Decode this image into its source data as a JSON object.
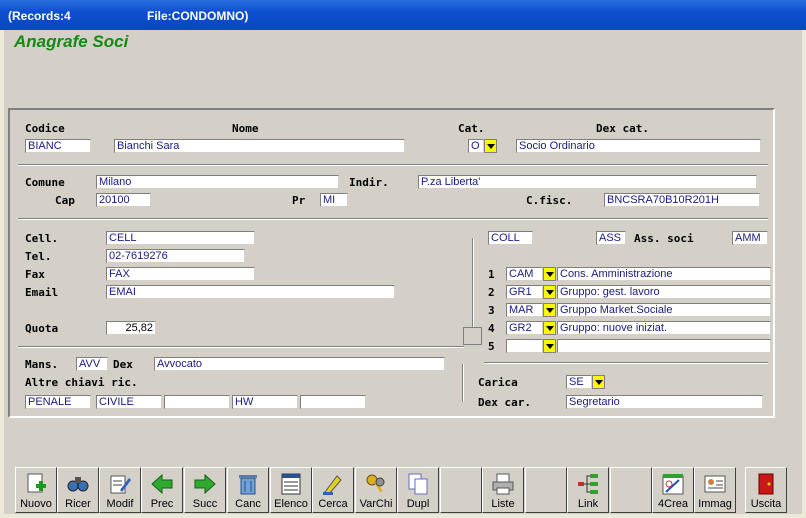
{
  "titlebar": {
    "records": "(Records:4",
    "file": "File:CONDOMNO)"
  },
  "form_title": "Anagrafe Soci",
  "labels": {
    "codice": "Codice",
    "nome": "Nome",
    "cat": "Cat.",
    "dex_cat": "Dex cat.",
    "comune": "Comune",
    "indir": "Indir.",
    "cap": "Cap",
    "pr": "Pr",
    "cfisc": "C.fisc.",
    "cell": "Cell.",
    "tel": "Tel.",
    "fax": "Fax",
    "email": "Email",
    "quota": "Quota",
    "mans": "Mans.",
    "dex": "Dex",
    "altre": "Altre chiavi ric.",
    "ass_soci": "Ass. soci",
    "carica": "Carica",
    "dex_car": "Dex car."
  },
  "fields": {
    "codice": "BIANC",
    "nome": "Bianchi Sara",
    "cat": "O",
    "dex_cat": "Socio Ordinario",
    "comune": "Milano",
    "indir": "P.za Liberta'",
    "cap": "20100",
    "pr": "MI",
    "cfisc": "BNCSRA70B10R201H",
    "cell": "CELL",
    "tel": "02-7619276",
    "fax": "FAX",
    "email": "EMAI",
    "quota": "25,82",
    "mans": "AVV",
    "dex": "Avvocato",
    "altre": [
      "PENALE",
      "CIVILE",
      "",
      "HW",
      ""
    ],
    "coll": "COLL",
    "ass": "ASS",
    "amm": "AMM",
    "carica": "SE",
    "dex_car": "Segretario"
  },
  "groups": [
    {
      "n": "1",
      "code": "CAM",
      "desc": "Cons. Amministrazione"
    },
    {
      "n": "2",
      "code": "GR1",
      "desc": "Gruppo: gest. lavoro"
    },
    {
      "n": "3",
      "code": "MAR",
      "desc": "Gruppo Market.Sociale"
    },
    {
      "n": "4",
      "code": "GR2",
      "desc": "Gruppo: nuove iniziat."
    },
    {
      "n": "5",
      "code": "",
      "desc": ""
    }
  ],
  "toolbar": {
    "nuovo": "Nuovo",
    "ricer": "Ricer",
    "modif": "Modif",
    "prec": "Prec",
    "succ": "Succ",
    "canc": "Canc",
    "elenco": "Elenco",
    "cerca": "Cerca",
    "varchi": "VarChi",
    "dupl": "Dupl",
    "liste": "Liste",
    "link": "Link",
    "crea4": "4Crea",
    "immag": "Immag",
    "uscita": "Uscita"
  },
  "colors": {
    "title_green": "#138a13",
    "titlebar_blue": "#0d4fcf",
    "dropdown_yellow": "#f8f800",
    "field_text": "#1a1a80"
  }
}
